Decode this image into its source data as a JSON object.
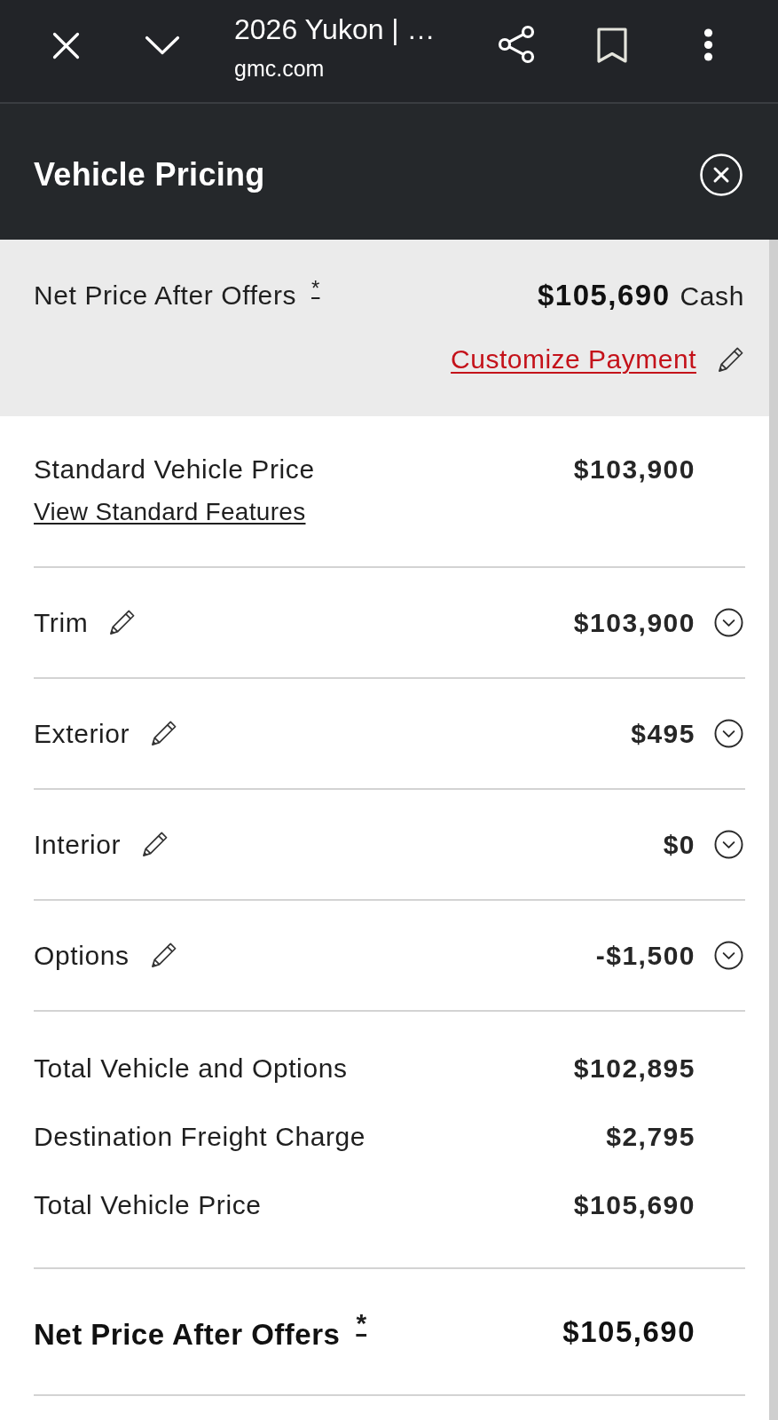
{
  "browser_bar": {
    "title": "2026 Yukon | …",
    "domain": "gmc.com"
  },
  "panel": {
    "title": "Vehicle Pricing"
  },
  "net_price_summary": {
    "label": "Net Price After Offers",
    "footnote": "*",
    "amount": "$105,690",
    "payment_type": "Cash",
    "customize_link": "Customize Payment"
  },
  "standard_price": {
    "label": "Standard Vehicle Price",
    "amount": "$103,900",
    "features_link": "View Standard Features"
  },
  "config_items": [
    {
      "label": "Trim",
      "amount": "$103,900",
      "expanded": false
    },
    {
      "label": "Exterior",
      "amount": "$495",
      "expanded": false
    },
    {
      "label": "Interior",
      "amount": "$0",
      "expanded": false
    },
    {
      "label": "Options",
      "amount": "-$1,500",
      "expanded": false
    }
  ],
  "totals": [
    {
      "label": "Total Vehicle and Options",
      "amount": "$102,895"
    },
    {
      "label": "Destination Freight Charge",
      "amount": "$2,795"
    },
    {
      "label": "Total Vehicle Price",
      "amount": "$105,690"
    }
  ],
  "net_price_total": {
    "label": "Net Price After Offers",
    "footnote": "*",
    "amount": "$105,690"
  }
}
